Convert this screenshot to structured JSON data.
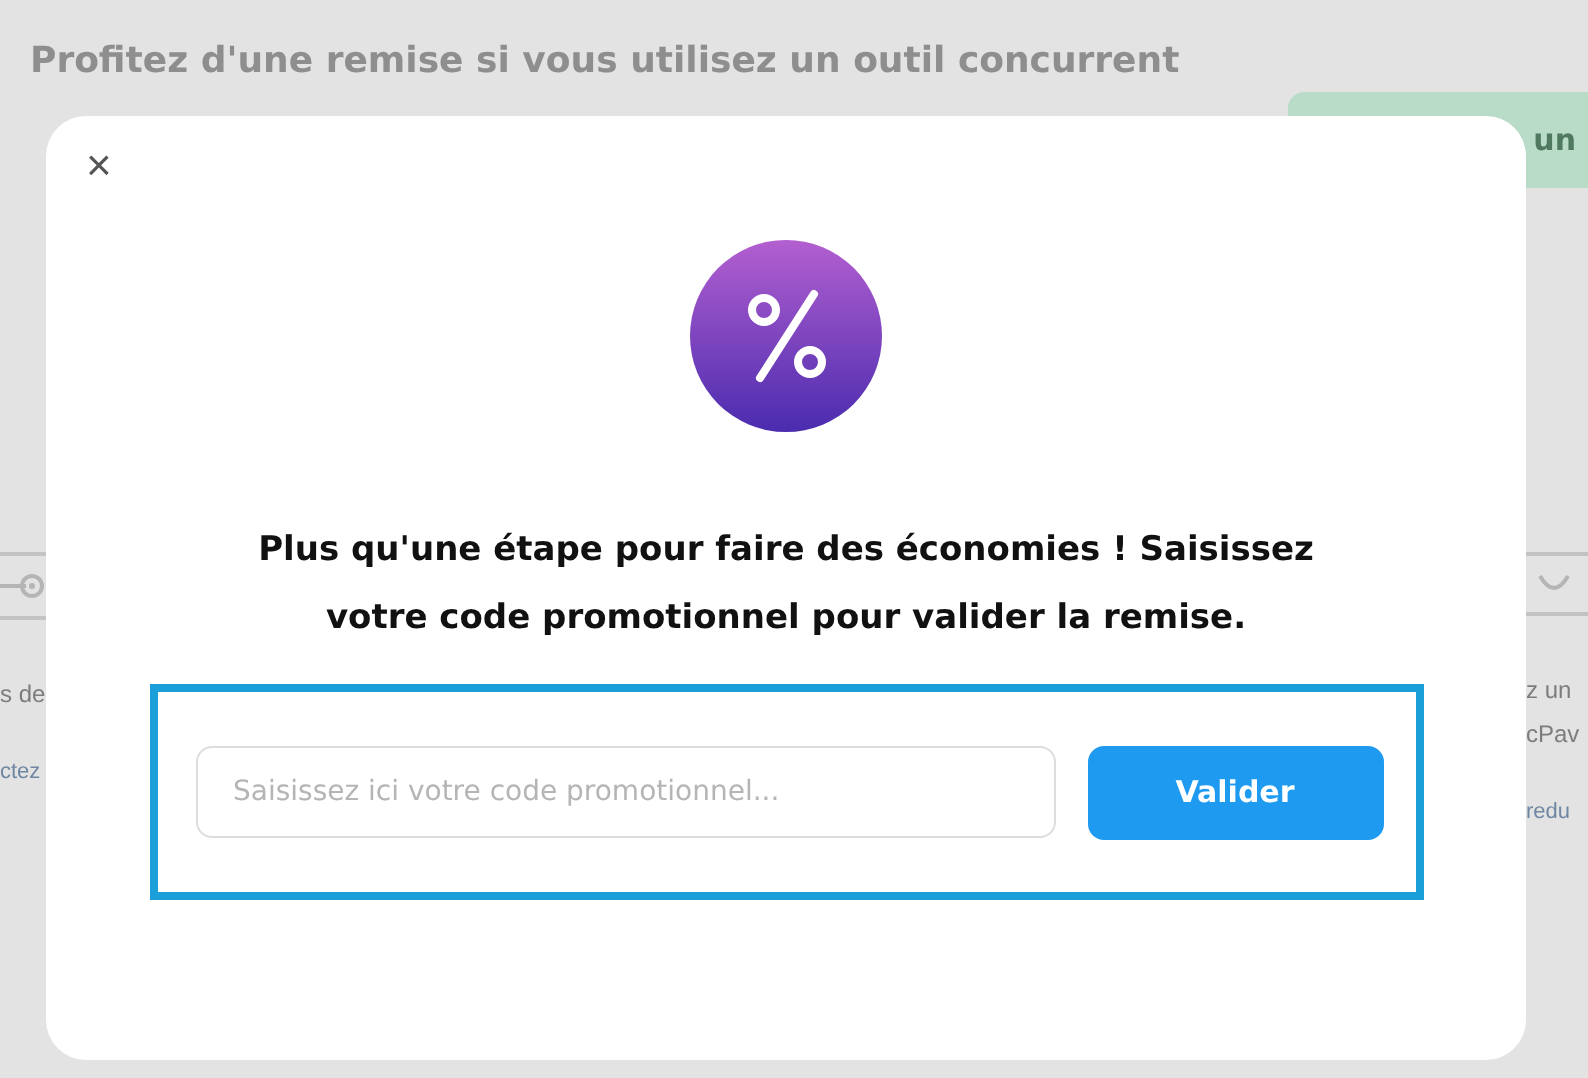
{
  "background_page": {
    "heading": "Profitez d'une remise si vous utilisez un outil concurrent",
    "button": "un",
    "left_fragments": [
      "s de",
      "ctez"
    ],
    "right_fragments": [
      "z un",
      "cPav",
      "redu"
    ]
  },
  "modal": {
    "close": "×",
    "message": "Plus qu'une étape pour faire des économies ! Saisissez votre code promotionnel pour valider la remise.",
    "promo_field": {
      "placeholder": "Saisissez ici votre code promotionnel..."
    },
    "submit_button": "Valider"
  }
}
